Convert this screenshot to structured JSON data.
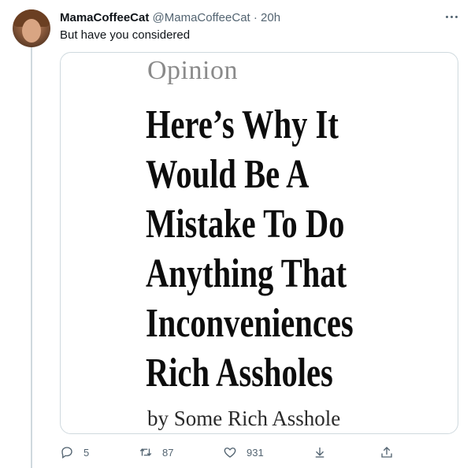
{
  "tweet": {
    "author_name": "MamaCoffeeCat",
    "author_handle": "@MamaCoffeeCat",
    "separator": "·",
    "time": "20h",
    "text": "But have you considered"
  },
  "media": {
    "section_label": "Opinion",
    "headline_lines": [
      "Here’s Why It",
      "Would Be A",
      "Mistake To Do",
      "Anything That",
      "Inconveniences",
      "Rich  Assholes"
    ],
    "byline": "by Some Rich Asshole"
  },
  "actions": {
    "reply_count": "5",
    "retweet_count": "87",
    "like_count": "931"
  },
  "icons": {
    "more": "more-icon",
    "reply": "reply-icon",
    "retweet": "retweet-icon",
    "like": "heart-icon",
    "bookmark": "download-arrow-icon",
    "share": "share-icon"
  },
  "colors": {
    "secondary_text": "#536471",
    "border": "#cfd9de"
  }
}
